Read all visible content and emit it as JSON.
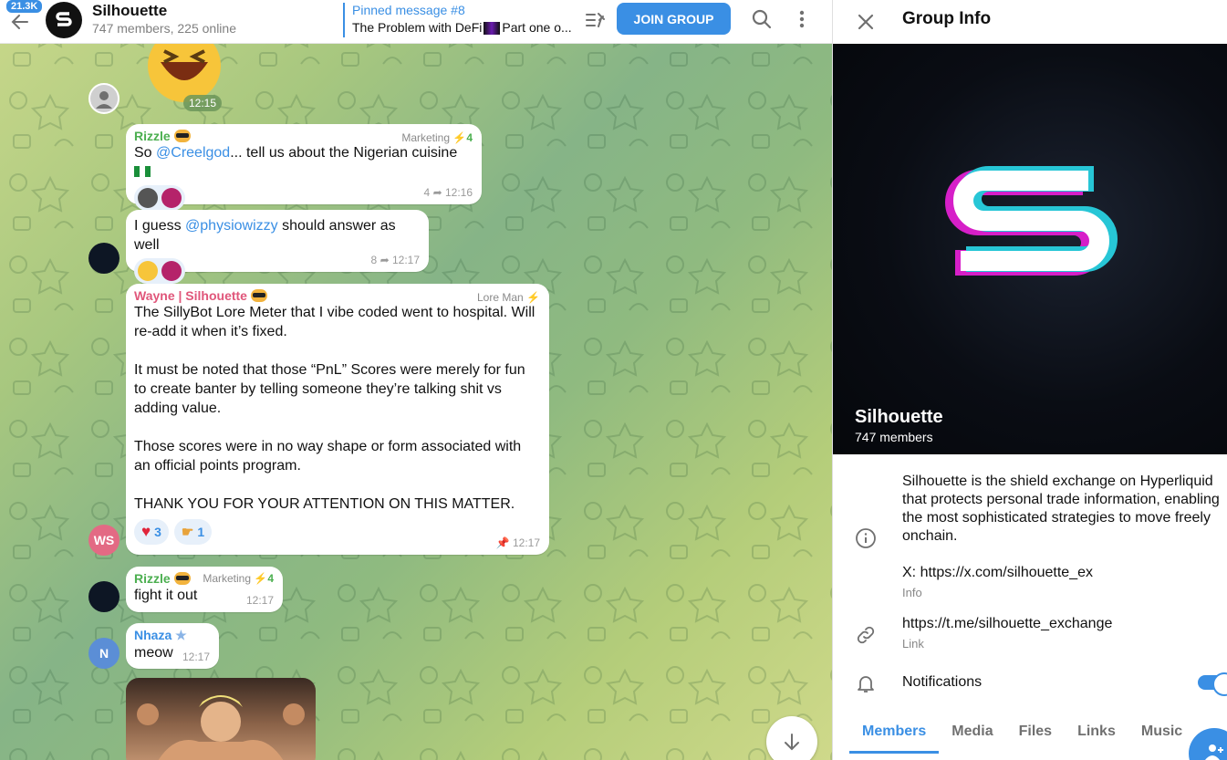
{
  "header": {
    "unread_count": "21.3K",
    "group_name": "Silhouette",
    "group_status": "747 members, 225 online",
    "pinned_title": "Pinned message #8",
    "pinned_text_before": "The Problem with DeFi",
    "pinned_text_after": "Part one o...",
    "join_label": "JOIN GROUP"
  },
  "messages": {
    "sticker_time": "12:15",
    "m1": {
      "sender": "Rizzle",
      "role": "Marketing",
      "role_level": "4",
      "text_before": "So ",
      "mention": "@Creelgod",
      "text_after": "... tell us about the Nigerian cuisine",
      "replies": "4",
      "time": "12:16"
    },
    "m2": {
      "text_before": "I guess ",
      "mention": "@physiowizzy",
      "text_after": " should answer as well",
      "replies": "8",
      "time": "12:17"
    },
    "m3": {
      "sender": "Wayne | Silhouette",
      "role": "Lore Man",
      "p1": "The SillyBot Lore Meter that I vibe coded went to hospital. Will re-add it when it’s fixed.",
      "p2": "It must be noted that those “PnL” Scores were merely for fun to create banter by telling someone they’re talking shit vs adding value.",
      "p3": "Those scores were in no way shape or form associated with an official points program.",
      "p4": "THANK YOU FOR YOUR ATTENTION ON THIS MATTER.",
      "react_heart": "3",
      "react_hand": "1",
      "time": "12:17",
      "avatar_initials": "WS"
    },
    "m4": {
      "sender": "Rizzle",
      "role": "Marketing",
      "role_level": "4",
      "text": "fight it out",
      "time": "12:17"
    },
    "m5": {
      "sender": "Nhaza",
      "text": "meow",
      "time": "12:17",
      "avatar_initials": "N"
    }
  },
  "info": {
    "title": "Group Info",
    "name": "Silhouette",
    "members": "747 members",
    "description": "Silhouette is the shield exchange on Hyperliquid that protects personal trade information, enabling the most sophisticated strategies to move freely onchain.",
    "x_link": "X: https://x.com/silhouette_ex",
    "info_label": "Info",
    "link": "https://t.me/silhouette_exchange",
    "link_label": "Link",
    "notifications_label": "Notifications",
    "notifications_on": true,
    "tabs": [
      "Members",
      "Media",
      "Files",
      "Links",
      "Music"
    ]
  },
  "colors": {
    "accent": "#3a8fe4",
    "green_name": "#4caf50",
    "pink_name": "#e0567a",
    "nhaza_name": "#3a8fe4"
  }
}
